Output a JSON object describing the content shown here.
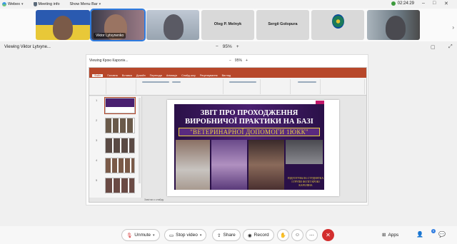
{
  "topbar": {
    "app_label": "Webex",
    "meeting_info_label": "Meeting info",
    "show_menu_label": "Show Menu Bar",
    "timer": "02:24:29"
  },
  "strip": {
    "tiles": [
      {
        "label": ""
      },
      {
        "label": "Viktor Lytvynenko"
      },
      {
        "label": ""
      },
      {
        "name": "Oleg P. Melnyk"
      },
      {
        "name": "Sergii Golopura"
      },
      {
        "name": ""
      },
      {
        "label": ""
      }
    ]
  },
  "viewing": {
    "label": "Viewing Viktor Lytvyne...",
    "zoom_minus": "−",
    "zoom_value": "95%",
    "zoom_plus": "+"
  },
  "share": {
    "header": "Viewing Крою Каролін...",
    "zoom_minus": "−",
    "zoom_value": "95%",
    "zoom_plus": "+"
  },
  "ppt": {
    "window_title": "",
    "tabs": [
      "Файл",
      "Головна",
      "Вставка",
      "Дизайн",
      "Переходи",
      "Анімація",
      "Слайд-шоу",
      "Рецензування",
      "Вигляд"
    ],
    "notes_label": "Замітки к слайду",
    "thumb_numbers": [
      "1",
      "2",
      "3",
      "4",
      "5",
      "6"
    ]
  },
  "slide": {
    "title_line1": "ЗВІТ ПРО ПРОХОДЖЕННЯ",
    "title_line2": "ВИРОБНИЧОЇ ПРАКТИКИ НА БАЗІ",
    "title_line3": "\"ВЕТЕРИНАРНОЇ ДОПОМОГИ 1ЮКК\"",
    "caption": "ПІДГОТУВАЛА СТУДЕНТКА І ГРУПИ ФІ ПІТ КРОЮ КАРОЛІНА"
  },
  "bottom": {
    "unmute_label": "Unmute",
    "stop_video_label": "Stop video",
    "share_label": "Share",
    "record_label": "Record",
    "apps_label": "Apps",
    "badge_count": "0"
  },
  "colors": {
    "accent": "#2d7be0",
    "end_call": "#d32f2f",
    "ppt_brand": "#b7472a",
    "slide_purple": "#4a2070",
    "slide_gold": "#e8d040"
  }
}
